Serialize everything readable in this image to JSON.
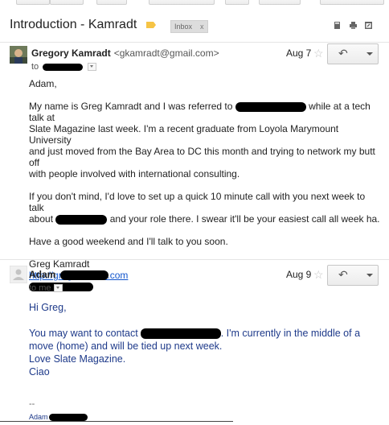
{
  "thread": {
    "subject": "Introduction - Kamradt",
    "label_chip": "Inbox",
    "label_chip_close": "x",
    "icons": [
      "print-icon",
      "new-window-icon",
      "archive-icon"
    ]
  },
  "message1": {
    "sender_name": "Gregory Kamradt",
    "sender_email": "<gkamradt@gmail.com>",
    "to_prefix": "to",
    "date": "Aug 7",
    "star": "☆",
    "reply_glyph": "↶",
    "greeting": "Adam,",
    "p1_a": "My name is Greg Kamradt and I was referred to",
    "p1_b": "while at a tech talk at",
    "p1_c": "Slate Magazine last week. I'm a recent graduate from Loyola Marymount University",
    "p1_d": "and just moved from the Bay Area to DC this month and trying to network my butt off",
    "p1_e": "with people involved with international consulting.",
    "p2_a": "If you don't mind, I'd love to set up a quick 10 minute call with you next week to talk",
    "p2_b": "about",
    "p2_c": "and your role there. I swear it'll be your easiest call all week ha.",
    "p3": "Have a good weekend and I'll talk to you soon.",
    "sig_name": "Greg Kamradt",
    "sig_link": "http://gregkamradt.com"
  },
  "message2": {
    "sender_name": "Adam",
    "to_line": "to me",
    "date": "Aug 9",
    "star": "☆",
    "reply_glyph": "↶",
    "greeting": "Hi Greg,",
    "p1_a": "You may want to contact",
    "p1_b": ". I'm currently in the middle of a",
    "p1_c": "move (home) and will be tied up next week.",
    "p1_d": "Love Slate Magazine.",
    "p1_e": "Ciao",
    "sig_dash": "--",
    "sig_name": "Adam"
  }
}
